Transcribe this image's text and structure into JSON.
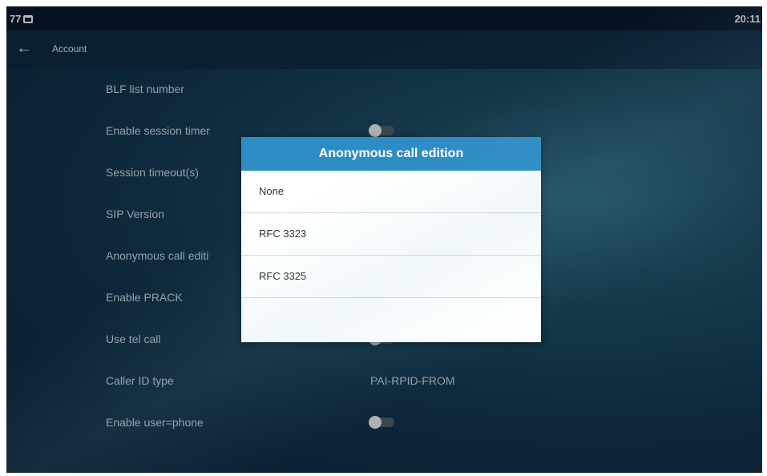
{
  "status_bar": {
    "left_text": "77",
    "icon": "desk-phone-icon",
    "time": "20:11"
  },
  "title_bar": {
    "back_icon": "back-arrow-icon",
    "back_glyph": "←",
    "title": "Account"
  },
  "rows": [
    {
      "label": "BLF list number"
    },
    {
      "label": "Enable session timer",
      "toggle": "off"
    },
    {
      "label": "Session timeout(s)"
    },
    {
      "label": "SIP Version"
    },
    {
      "label": "Anonymous call editi"
    },
    {
      "label": "Enable PRACK"
    },
    {
      "label": "Use tel call",
      "toggle": "off"
    },
    {
      "label": "Caller ID type",
      "value": "PAI-RPID-FROM"
    },
    {
      "label": "Enable user=phone",
      "toggle": "off"
    }
  ],
  "dialog": {
    "title": "Anonymous call edition",
    "options": [
      "None",
      "RFC 3323",
      "RFC 3325",
      ""
    ]
  },
  "colors": {
    "dialog_header": "#2e8cc4",
    "status_bar": "#0b1a2e",
    "background": "#1d4e67"
  }
}
